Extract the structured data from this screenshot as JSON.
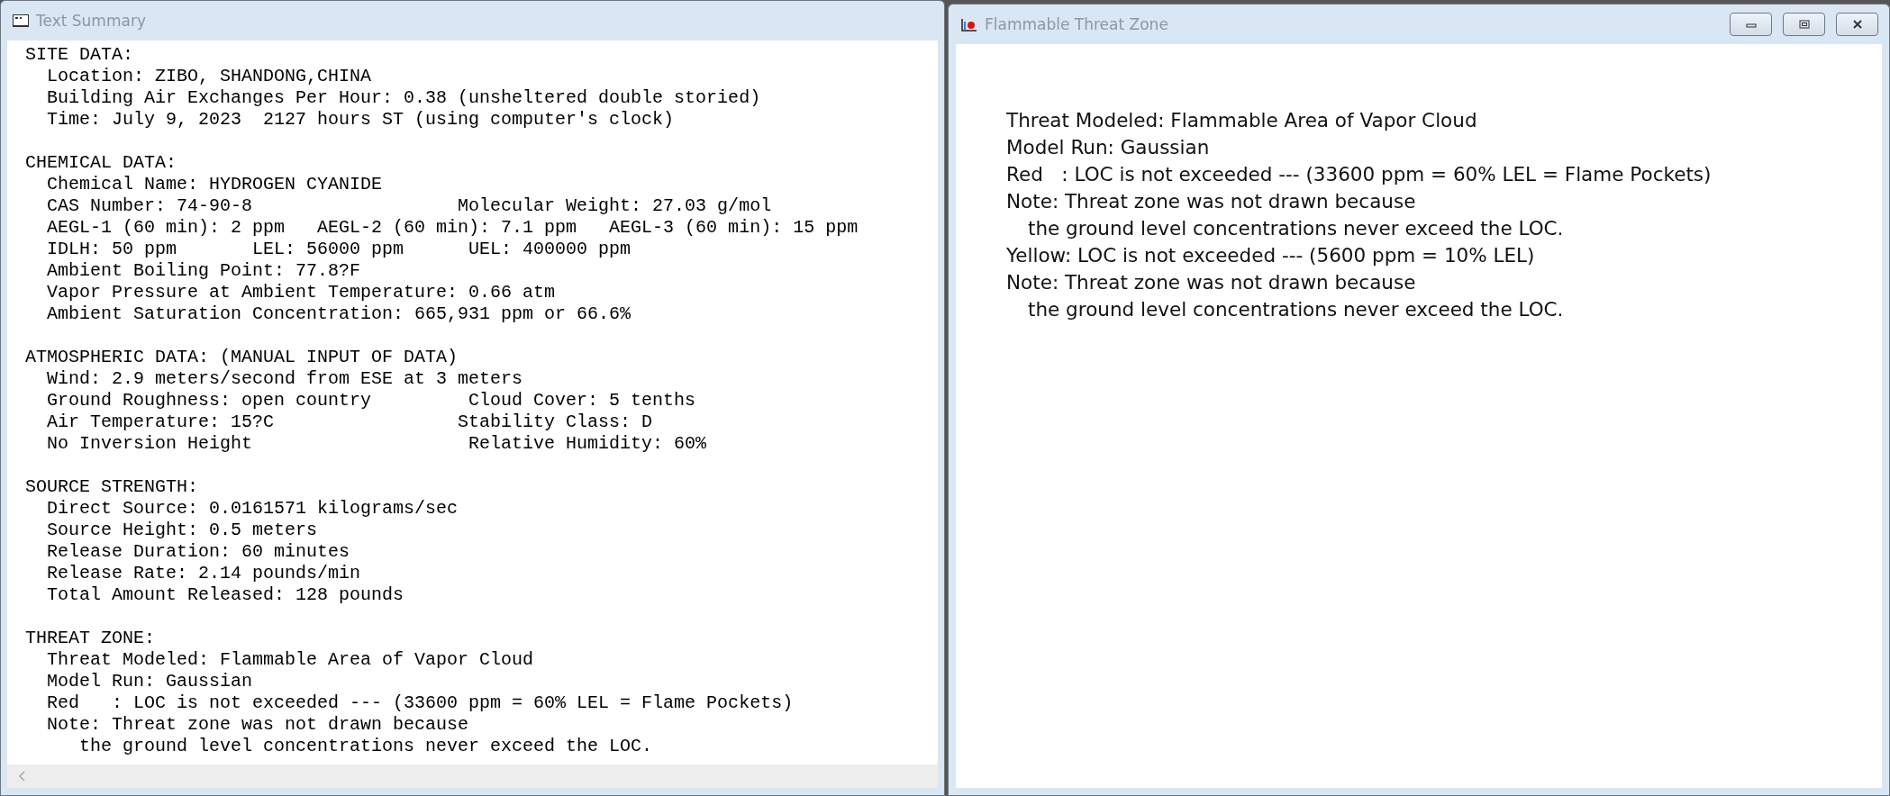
{
  "summary_window": {
    "title": "Text Summary",
    "sections": [
      {
        "heading": "SITE DATA:",
        "lines": [
          "Location: ZIBO, SHANDONG,CHINA",
          "Building Air Exchanges Per Hour: 0.38 (unsheltered double storied)",
          "Time: July 9, 2023  2127 hours ST (using computer's clock)"
        ]
      },
      {
        "heading": "CHEMICAL DATA:",
        "lines": [
          "Chemical Name: HYDROGEN CYANIDE",
          "CAS Number: 74-90-8                   Molecular Weight: 27.03 g/mol",
          "AEGL-1 (60 min): 2 ppm   AEGL-2 (60 min): 7.1 ppm   AEGL-3 (60 min): 15 ppm",
          "IDLH: 50 ppm       LEL: 56000 ppm      UEL: 400000 ppm",
          "Ambient Boiling Point: 77.8?F",
          "Vapor Pressure at Ambient Temperature: 0.66 atm",
          "Ambient Saturation Concentration: 665,931 ppm or 66.6%"
        ]
      },
      {
        "heading": "ATMOSPHERIC DATA: (MANUAL INPUT OF DATA)",
        "lines": [
          "Wind: 2.9 meters/second from ESE at 3 meters",
          "Ground Roughness: open country         Cloud Cover: 5 tenths",
          "Air Temperature: 15?C                 Stability Class: D",
          "No Inversion Height                    Relative Humidity: 60%"
        ]
      },
      {
        "heading": "SOURCE STRENGTH:",
        "lines": [
          "Direct Source: 0.0161571 kilograms/sec",
          "Source Height: 0.5 meters",
          "Release Duration: 60 minutes",
          "Release Rate: 2.14 pounds/min",
          "Total Amount Released: 128 pounds"
        ]
      },
      {
        "heading": "THREAT ZONE:",
        "lines": [
          "Threat Modeled: Flammable Area of Vapor Cloud",
          "Model Run: Gaussian",
          "Red   : LOC is not exceeded --- (33600 ppm = 60% LEL = Flame Pockets)",
          "Note: Threat zone was not drawn because",
          "   the ground level concentrations never exceed the LOC."
        ]
      }
    ]
  },
  "threat_window": {
    "title": "Flammable Threat Zone",
    "lines": [
      {
        "kind": "line",
        "text": "Threat Modeled: Flammable Area of Vapor Cloud"
      },
      {
        "kind": "line",
        "text": "Model Run: Gaussian"
      },
      {
        "kind": "line",
        "text": "Red   : LOC is not exceeded --- (33600 ppm = 60% LEL = Flame Pockets)"
      },
      {
        "kind": "line",
        "text": "Note: Threat zone was not drawn because"
      },
      {
        "kind": "continuation",
        "text": "the ground level concentrations never exceed the LOC."
      },
      {
        "kind": "line",
        "text": "Yellow: LOC is not exceeded --- (5600 ppm = 10% LEL)"
      },
      {
        "kind": "line",
        "text": "Note: Threat zone was not drawn because"
      },
      {
        "kind": "continuation",
        "text": "the ground level concentrations never exceed the LOC."
      }
    ]
  }
}
